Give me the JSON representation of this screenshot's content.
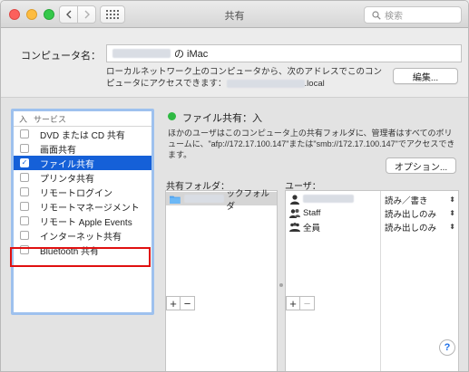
{
  "window": {
    "title": "共有",
    "search_placeholder": "検索"
  },
  "computer_name": {
    "label": "コンピュータ名：",
    "value_suffix": "の iMac",
    "address_note_before": "ローカルネットワーク上のコンピュータから、次のアドレスでこのコンピュータにアクセスできます：",
    "address_note_after": ".local",
    "edit_button": "編集..."
  },
  "services": {
    "header_on": "入",
    "header_service": "サービス",
    "items": [
      {
        "label": "DVD または CD 共有",
        "checked": false,
        "selected": false
      },
      {
        "label": "画面共有",
        "checked": false,
        "selected": false
      },
      {
        "label": "ファイル共有",
        "checked": true,
        "selected": true
      },
      {
        "label": "プリンタ共有",
        "checked": false,
        "selected": false
      },
      {
        "label": "リモートログイン",
        "checked": false,
        "selected": false
      },
      {
        "label": "リモートマネージメント",
        "checked": false,
        "selected": false
      },
      {
        "label": "リモート Apple Events",
        "checked": false,
        "selected": false
      },
      {
        "label": "インターネット共有",
        "checked": false,
        "selected": false
      },
      {
        "label": "Bluetooth 共有",
        "checked": false,
        "selected": false
      }
    ],
    "checkmark": "✓"
  },
  "file_sharing": {
    "status": "ファイル共有：入",
    "status_color": "#2fb943",
    "description": "ほかのユーザはこのコンピュータ上の共有フォルダに、管理者はすべてのボリュームに、\"afp://172.17.100.147\"または\"smb://172.17.100.147\"でアクセスできます。",
    "options_button": "オプション..."
  },
  "shared_folders": {
    "label": "共有フォルダ：",
    "items": [
      {
        "name_suffix": "ックフォルダ"
      }
    ]
  },
  "users": {
    "label": "ユーザ：",
    "items": [
      {
        "name": "",
        "permission": "読み／書き",
        "icon": "single-user-icon"
      },
      {
        "name": "Staff",
        "permission": "読み出しのみ",
        "icon": "group-icon"
      },
      {
        "name": "全員",
        "permission": "読み出しのみ",
        "icon": "everyone-icon"
      }
    ]
  },
  "buttons": {
    "plus": "+",
    "minus": "−",
    "help": "?",
    "updown": "⌃⌄"
  },
  "colors": {
    "selection": "#1560d8",
    "highlight_frame": "#e01010",
    "list_focus": "#9ec1ee"
  }
}
